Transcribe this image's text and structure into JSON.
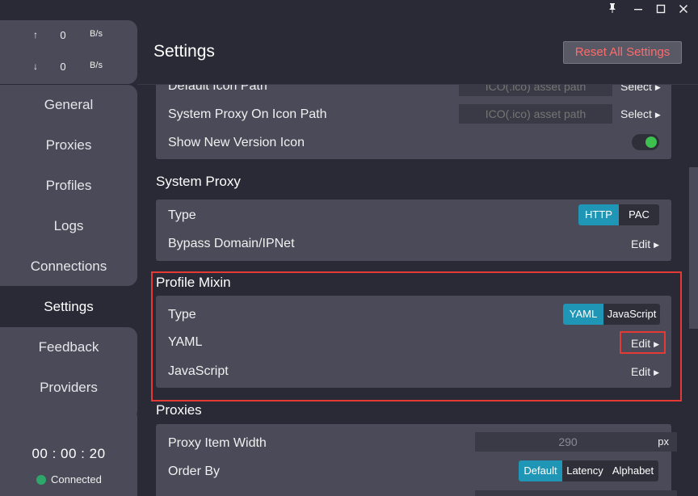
{
  "window": {
    "controls": {
      "pin": "pin-icon",
      "minimize": "minimize-icon",
      "maximize": "maximize-icon",
      "close": "close-icon"
    }
  },
  "traffic": {
    "upload": {
      "arrow": "↑",
      "value": "0",
      "unit": "B/s"
    },
    "download": {
      "arrow": "↓",
      "value": "0",
      "unit": "B/s"
    }
  },
  "nav": {
    "general": "General",
    "proxies": "Proxies",
    "profiles": "Profiles",
    "logs": "Logs",
    "connections": "Connections",
    "settings": "Settings",
    "feedback": "Feedback",
    "providers": "Providers"
  },
  "status": {
    "clock": "00 : 00 : 20",
    "connection": "Connected",
    "connection_color": "#2ea86a"
  },
  "header": {
    "title": "Settings",
    "reset_label": "Reset All Settings"
  },
  "icon_section": {
    "default_icon_label": "Default Icon Path",
    "default_icon_placeholder": "ICO(.ico) asset path",
    "system_proxy_icon_label": "System Proxy On Icon Path",
    "system_proxy_icon_placeholder": "ICO(.ico) asset path",
    "select_label": "Select",
    "show_new_version_label": "Show New Version Icon",
    "show_new_version_on": true
  },
  "system_proxy": {
    "title": "System Proxy",
    "type_label": "Type",
    "type_options": [
      "HTTP",
      "PAC"
    ],
    "type_selected": "HTTP",
    "bypass_label": "Bypass Domain/IPNet",
    "edit_label": "Edit"
  },
  "profile_mixin": {
    "title": "Profile Mixin",
    "type_label": "Type",
    "type_options": [
      "YAML",
      "JavaScript"
    ],
    "type_selected": "YAML",
    "yaml_label": "YAML",
    "javascript_label": "JavaScript",
    "edit_label": "Edit"
  },
  "proxies_section": {
    "title": "Proxies",
    "item_width_label": "Proxy Item Width",
    "item_width_value": "290",
    "item_width_unit": "px",
    "order_by_label": "Order By",
    "order_options": [
      "Default",
      "Latency",
      "Alphabet"
    ],
    "order_selected": "Default"
  },
  "colors": {
    "accent": "#1f96b5",
    "danger": "#ff6b6b",
    "toggle_on": "#3ec04f",
    "highlight": "#e53935"
  }
}
